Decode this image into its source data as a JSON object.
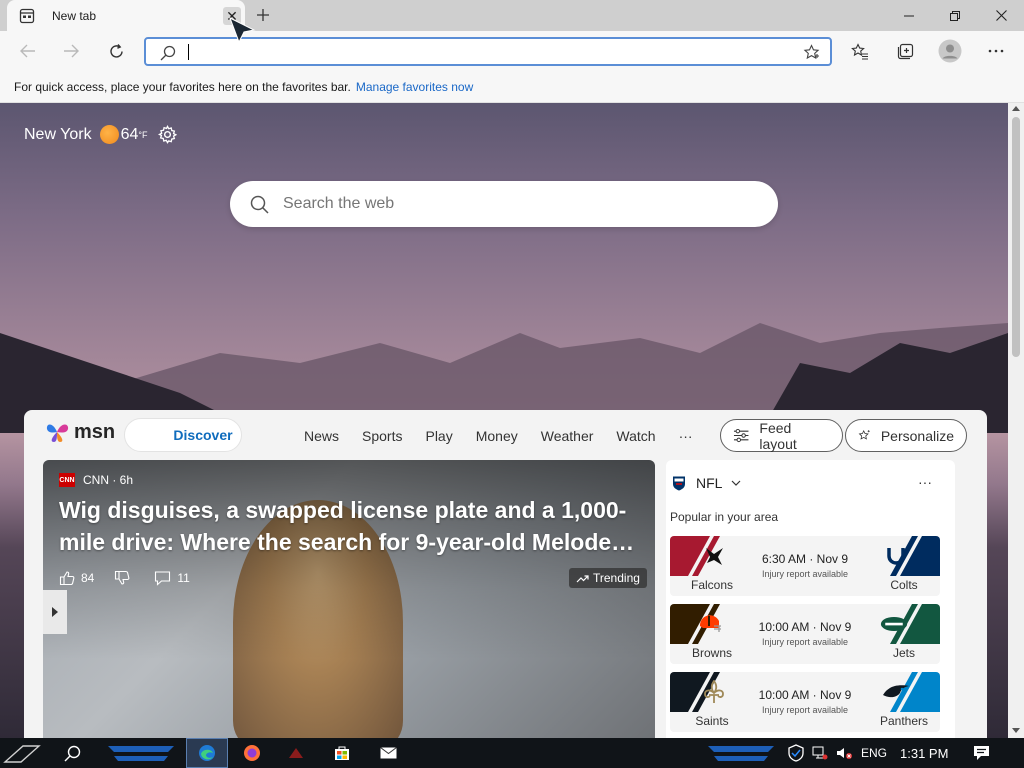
{
  "browser": {
    "tab_title": "New tab",
    "tab_close": "✕",
    "favorites_hint": "For quick access, place your favorites here on the favorites bar.",
    "favorites_link": "Manage favorites now"
  },
  "weather": {
    "city": "New York",
    "temp": "64",
    "unit": "°F"
  },
  "search": {
    "placeholder": "Search the web"
  },
  "msn": {
    "logo_text": "msn",
    "discover": "Discover",
    "nav": [
      "News",
      "Sports",
      "Play",
      "Money",
      "Weather",
      "Watch",
      "···"
    ],
    "feed_layout": "Feed layout",
    "personalize": "Personalize"
  },
  "hero": {
    "source_badge": "CNN",
    "source": "CNN · 6h",
    "title": "Wig disguises, a swapped license plate and a 1,000-mile drive: Where the search for 9-year-old Melode…",
    "likes": "84",
    "comments": "11",
    "trending": "Trending"
  },
  "sports": {
    "league": "NFL",
    "more": "···",
    "subtitle": "Popular in your area",
    "games": [
      {
        "home": "Falcons",
        "away": "Colts",
        "time": "6:30 AM · Nov 9",
        "note": "Injury report available",
        "home_color": "#a71930",
        "away_color": "#002c5f"
      },
      {
        "home": "Browns",
        "away": "Jets",
        "time": "10:00 AM · Nov 9",
        "note": "Injury report available",
        "home_color": "#311d00",
        "away_color": "#125740"
      },
      {
        "home": "Saints",
        "away": "Panthers",
        "time": "10:00 AM · Nov 9",
        "note": "Injury report available",
        "home_color": "#101820",
        "away_color": "#0085ca"
      }
    ]
  },
  "taskbar": {
    "lang": "ENG",
    "time": "1:31 PM"
  }
}
